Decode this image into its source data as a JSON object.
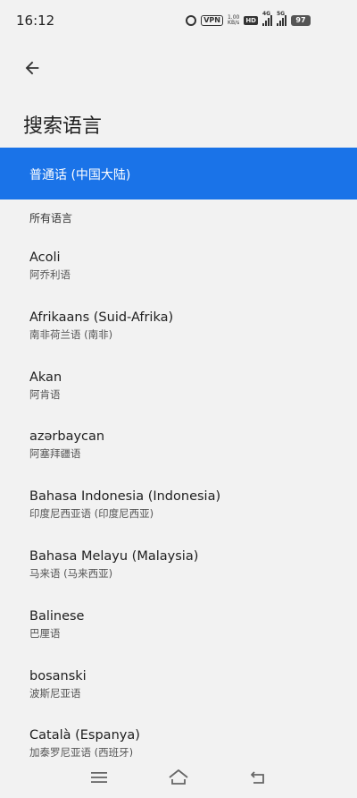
{
  "status_bar": {
    "time": "16:12",
    "vpn": "VPN",
    "net_speed_value": "1.00",
    "net_speed_unit": "KB/s",
    "hd": "HD",
    "signal_1": "4G",
    "signal_2": "5G",
    "battery": "97"
  },
  "header": {
    "title": "搜索语言"
  },
  "selected": {
    "label": "普通话 (中国大陆)"
  },
  "section": {
    "all_languages": "所有语言"
  },
  "languages": [
    {
      "name": "Acoli",
      "native": "阿乔利语"
    },
    {
      "name": "Afrikaans (Suid-Afrika)",
      "native": "南非荷兰语 (南非)"
    },
    {
      "name": "Akan",
      "native": "阿肯语"
    },
    {
      "name": "azərbaycan",
      "native": "阿塞拜疆语"
    },
    {
      "name": "Bahasa Indonesia (Indonesia)",
      "native": "印度尼西亚语 (印度尼西亚)"
    },
    {
      "name": "Bahasa Melayu (Malaysia)",
      "native": "马来语 (马来西亚)"
    },
    {
      "name": "Balinese",
      "native": "巴厘语"
    },
    {
      "name": "bosanski",
      "native": "波斯尼亚语"
    },
    {
      "name": "Català (Espanya)",
      "native": "加泰罗尼亚语 (西班牙)"
    }
  ],
  "colors": {
    "accent": "#1a73e8",
    "background": "#f2f2f2"
  },
  "icons": {
    "back": "arrow-back-icon",
    "menu": "menu-icon",
    "home": "home-icon",
    "return": "return-icon"
  }
}
